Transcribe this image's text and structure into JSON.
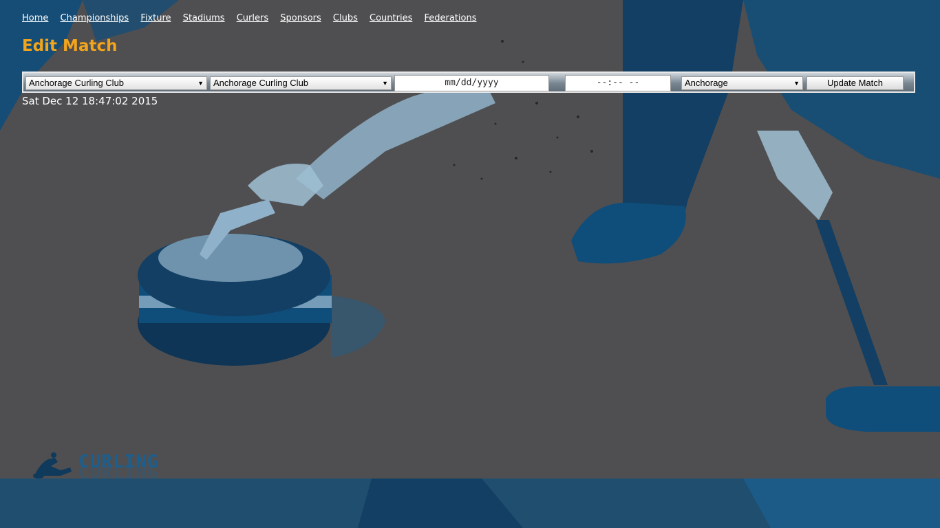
{
  "nav": {
    "items": [
      "Home",
      "Championships",
      "Fixture",
      "Stadiums",
      "Curlers",
      "Sponsors",
      "Clubs",
      "Countries",
      "Federations"
    ]
  },
  "page": {
    "title": "Edit Match",
    "timestamp": "Sat Dec 12 18:47:02 2015"
  },
  "form": {
    "home_club": "Anchorage Curling Club",
    "away_club": "Anchorage Curling Club",
    "date_placeholder": "mm/dd/yyyy",
    "time_placeholder": "--:-- --",
    "stadium": "Anchorage",
    "submit_label": "Update Match"
  },
  "logo": {
    "text": "CURLING"
  },
  "colors": {
    "title": "#f2a51c",
    "background": "#4f4f51",
    "art": "#0f4d7a"
  },
  "icons": {
    "dropdown": "triangle-down"
  }
}
